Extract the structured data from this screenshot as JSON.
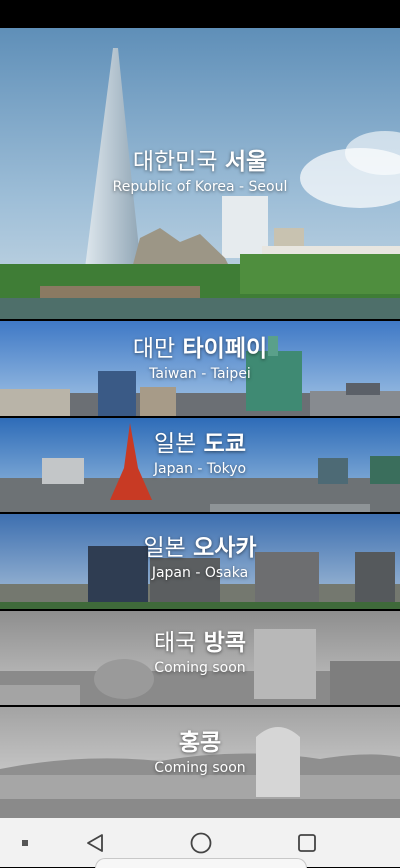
{
  "cities": [
    {
      "title_prefix": "대한민국",
      "title_bold": "서울",
      "subtitle": "Republic of Korea - Seoul"
    },
    {
      "title_prefix": "대만",
      "title_bold": "타이페이",
      "subtitle": "Taiwan - Taipei"
    },
    {
      "title_prefix": "일본",
      "title_bold": "도쿄",
      "subtitle": "Japan - Tokyo"
    },
    {
      "title_prefix": "일본",
      "title_bold": "오사카",
      "subtitle": "Japan - Osaka"
    },
    {
      "title_prefix": "태국",
      "title_bold": "방콕",
      "subtitle": "Coming soon"
    },
    {
      "title_prefix": "",
      "title_bold": "홍콩",
      "subtitle": "Coming soon"
    }
  ],
  "nav": {
    "menu_icon": "square-dot-icon",
    "back_icon": "triangle-back-icon",
    "home_icon": "circle-home-icon",
    "recents_icon": "square-recents-icon"
  }
}
